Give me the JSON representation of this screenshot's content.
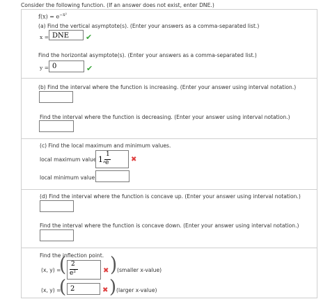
{
  "intro": "Consider the following function. (If an answer does not exist, enter DNE.)",
  "function": {
    "lhs": "f(x) = e",
    "exponent": "−x²"
  },
  "part_a": {
    "q_vertical": "(a) Find the vertical asymptote(s). (Enter your answers as a comma-separated list.)",
    "x_label": "x =",
    "x_value": "DNE",
    "q_horizontal": "Find the horizontal asymptote(s). (Enter your answers as a comma-separated list.)",
    "y_label": "y =",
    "y_value": "0"
  },
  "part_b": {
    "q_increasing": "(b) Find the interval where the function is increasing. (Enter your answer using interval notation.)",
    "q_decreasing": "Find the interval where the function is decreasing. (Enter your answer using interval notation.)"
  },
  "part_c": {
    "q": "(c) Find the local maximum and minimum values.",
    "max_label": "local maximum value",
    "max_prefix": "1,",
    "max_num": "1",
    "max_den": "e",
    "min_label": "local minimum value"
  },
  "part_d": {
    "q_up": "(d) Find the interval where the function is concave up. (Enter your answer using interval notation.)",
    "q_down": "Find the interval where the function is concave down. (Enter your answer using interval notation.)",
    "q_inflection": "Find the inflection point.",
    "xy_label": "(x, y) =",
    "p1_num": "2",
    "p1_den": "e²",
    "p1_note": "(smaller x-value)",
    "p2_value": "2",
    "p2_note": "(larger x-value)"
  },
  "icons": {
    "correct": "check-icon",
    "incorrect": "x-icon"
  },
  "colors": {
    "correct": "#3aa53a",
    "incorrect": "#e04040"
  }
}
